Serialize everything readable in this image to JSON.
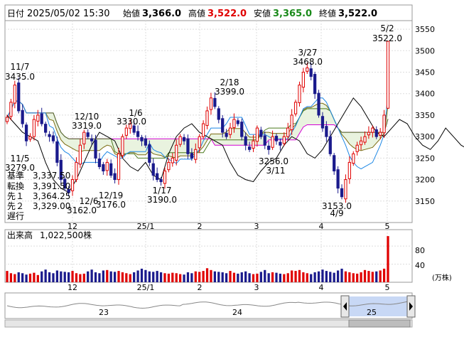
{
  "header": {
    "date_label": "日付",
    "date_value": "2025/05/02 15:30",
    "open_label": "始値",
    "open_value": "3,366.0",
    "high_label": "高値",
    "high_value": "3,522.0",
    "low_label": "安値",
    "low_value": "3,365.0",
    "close_label": "終値",
    "close_value": "3,522.0"
  },
  "legend": [
    {
      "label": "基準",
      "value": "3,337.50",
      "color": "#4b7a1e"
    },
    {
      "label": "転換",
      "value": "3,391.50",
      "color": "#1565c0"
    },
    {
      "label": "先１",
      "value": "3,364.25",
      "color": "#7a6a10"
    },
    {
      "label": "先２",
      "value": "3,329.00",
      "color": "#d400d4"
    },
    {
      "label": "遅行",
      "value": "",
      "color": "#000000"
    }
  ],
  "volume": {
    "label": "出来高",
    "value": "1,022,500株",
    "unit": "(万株)",
    "ticks": [
      "80",
      "40"
    ]
  },
  "colors": {
    "up": "#e00000",
    "down": "#1a1a8c",
    "kijun": "#4b7a1e",
    "tenkan": "#1e88e5",
    "senkou1": "#7a6a10",
    "senkou2": "#d400d4",
    "chikou": "#000000",
    "high_text": "#e00000",
    "low_text": "#1a8a1a",
    "cloud": "#e9f3df"
  },
  "chart_data": {
    "type": "candlestick",
    "ylim": [
      3100,
      3570
    ],
    "yticks": [
      3150,
      3200,
      3250,
      3300,
      3350,
      3400,
      3450,
      3500,
      3550
    ],
    "x_month_labels": [
      "12",
      "25/1",
      "2",
      "3",
      "4",
      "5"
    ],
    "annotations": [
      {
        "date": "11/7",
        "value": "3435.0"
      },
      {
        "date": "11/5",
        "value": "3279.0"
      },
      {
        "date": "12/10",
        "value": "3319.0"
      },
      {
        "date": "1/6",
        "value": "3330.0"
      },
      {
        "date": "12/6",
        "value": "3162.0"
      },
      {
        "date": "12/19",
        "value": "3176.0"
      },
      {
        "date": "1/17",
        "value": "3190.0"
      },
      {
        "date": "2/18",
        "value": "3399.0"
      },
      {
        "date": "3/11",
        "value": "3256.0"
      },
      {
        "date": "3/27",
        "value": "3468.0"
      },
      {
        "date": "4/9",
        "value": "3153.0"
      },
      {
        "date": "5/2",
        "value": "3522.0"
      }
    ],
    "closes": [
      3345,
      3380,
      3420,
      3360,
      3330,
      3290,
      3300,
      3340,
      3350,
      3330,
      3310,
      3300,
      3290,
      3240,
      3200,
      3180,
      3170,
      3200,
      3240,
      3280,
      3310,
      3300,
      3290,
      3250,
      3230,
      3220,
      3240,
      3210,
      3200,
      3260,
      3300,
      3320,
      3330,
      3310,
      3300,
      3290,
      3280,
      3240,
      3210,
      3200,
      3195,
      3220,
      3240,
      3250,
      3280,
      3300,
      3290,
      3260,
      3250,
      3270,
      3300,
      3330,
      3360,
      3390,
      3370,
      3340,
      3310,
      3300,
      3320,
      3340,
      3330,
      3300,
      3280,
      3270,
      3290,
      3320,
      3300,
      3280,
      3270,
      3300,
      3290,
      3280,
      3300,
      3320,
      3350,
      3380,
      3420,
      3450,
      3460,
      3440,
      3400,
      3350,
      3320,
      3300,
      3260,
      3220,
      3180,
      3160,
      3200,
      3240,
      3260,
      3280,
      3290,
      3300,
      3310,
      3320,
      3300,
      3310,
      3350,
      3522
    ],
    "volumes": [
      25,
      20,
      18,
      22,
      20,
      17,
      19,
      21,
      16,
      24,
      28,
      22,
      20,
      26,
      24,
      23,
      22,
      25,
      20,
      18,
      19,
      24,
      28,
      22,
      20,
      26,
      27,
      24,
      23,
      25,
      22,
      20,
      18,
      22,
      26,
      30,
      27,
      24,
      23,
      25,
      22,
      20,
      19,
      21,
      20,
      18,
      17,
      22,
      20,
      24,
      23,
      25,
      31,
      27,
      24,
      23,
      22,
      20,
      25,
      21,
      19,
      22,
      24,
      20,
      18,
      19,
      23,
      27,
      20,
      22,
      21,
      19,
      18,
      20,
      26,
      25,
      27,
      22,
      20,
      18,
      22,
      24,
      28,
      25,
      23,
      21,
      26,
      30,
      24,
      22,
      20,
      19,
      22,
      27,
      25,
      23,
      24,
      26,
      30,
      102
    ],
    "volume_ylim": [
      0,
      110
    ]
  },
  "bottom": {
    "year_labels": [
      "23",
      "24",
      "25"
    ]
  }
}
